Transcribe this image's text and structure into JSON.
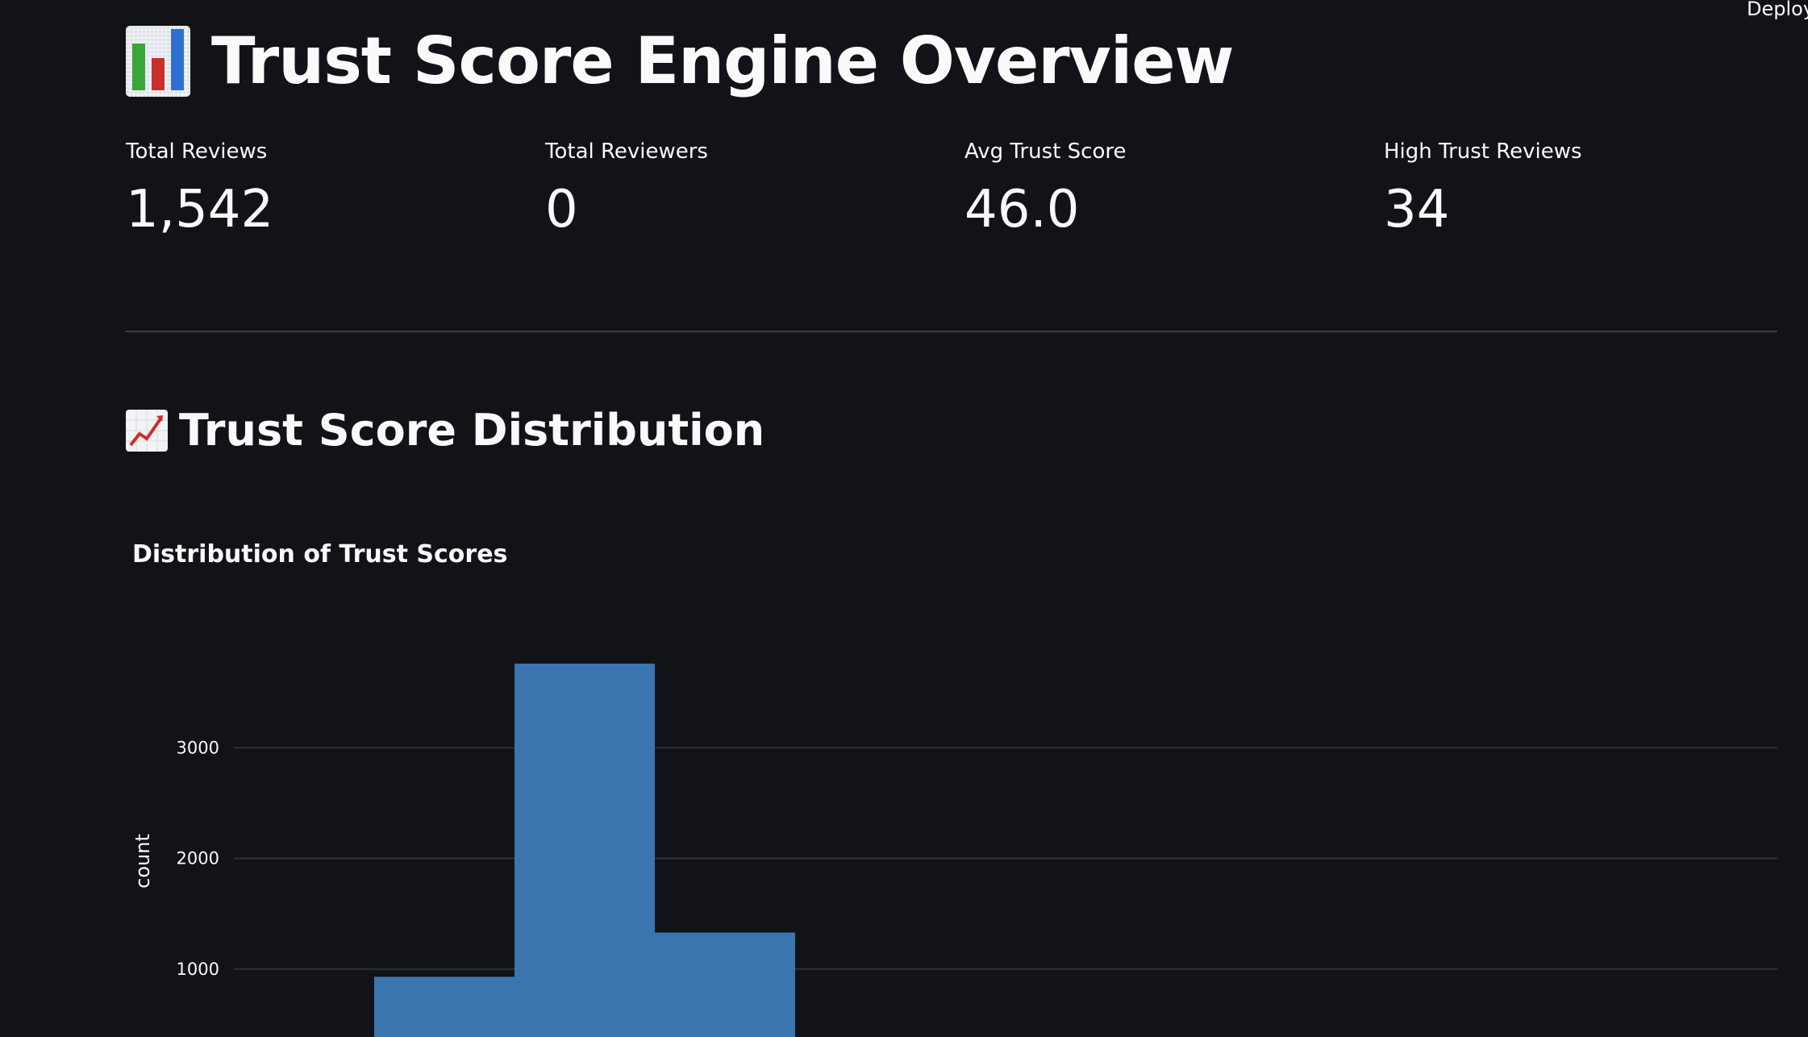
{
  "header": {
    "deploy_label": "Deploy"
  },
  "page": {
    "title": "Trust Score Engine Overview",
    "title_icon": "bar-chart-icon"
  },
  "metrics": [
    {
      "label": "Total Reviews",
      "value": "1,542"
    },
    {
      "label": "Total Reviewers",
      "value": "0"
    },
    {
      "label": "Avg Trust Score",
      "value": "46.0"
    },
    {
      "label": "High Trust Reviews",
      "value": "34"
    }
  ],
  "section": {
    "title": "Trust Score Distribution",
    "icon": "chart-increasing-icon"
  },
  "chart_data": {
    "type": "bar",
    "title": "Distribution of Trust Scores",
    "ylabel": "count",
    "xlabel": "",
    "ylim": [
      0,
      4000
    ],
    "yticks": [
      1000,
      2000,
      3000
    ],
    "grid": true,
    "color": "#3b75af",
    "bins": [
      {
        "from": 0,
        "to": 1,
        "value": 930
      },
      {
        "from": 1,
        "to": 2,
        "value": 3760
      },
      {
        "from": 2,
        "to": 3,
        "value": 1330
      }
    ]
  },
  "colors": {
    "background": "#111318",
    "text": "#fafafa",
    "bar": "#3b75af",
    "grid": "#2d3038"
  }
}
